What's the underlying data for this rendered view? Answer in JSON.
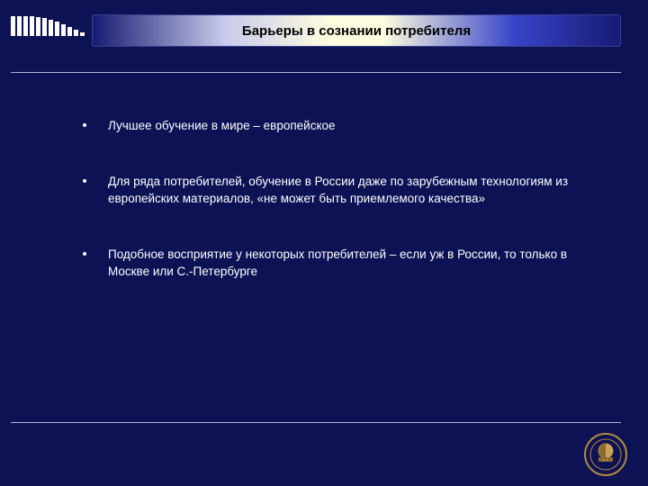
{
  "title": "Барьеры в сознании потребителя",
  "bullets": [
    "Лучшее обучение в мире – европейское",
    "Для ряда потребителей, обучение в России даже по зарубежным технологиям из европейских материалов, «не может быть приемлемого качества»",
    "Подобное восприятие у некоторых потребителей – если уж в России, то только в Москве или С.-Петербурге"
  ],
  "comb_heights": [
    22,
    22,
    22,
    22,
    21,
    20,
    18,
    16,
    13,
    10,
    7,
    4
  ],
  "seal_label": "Университетская эмблема"
}
